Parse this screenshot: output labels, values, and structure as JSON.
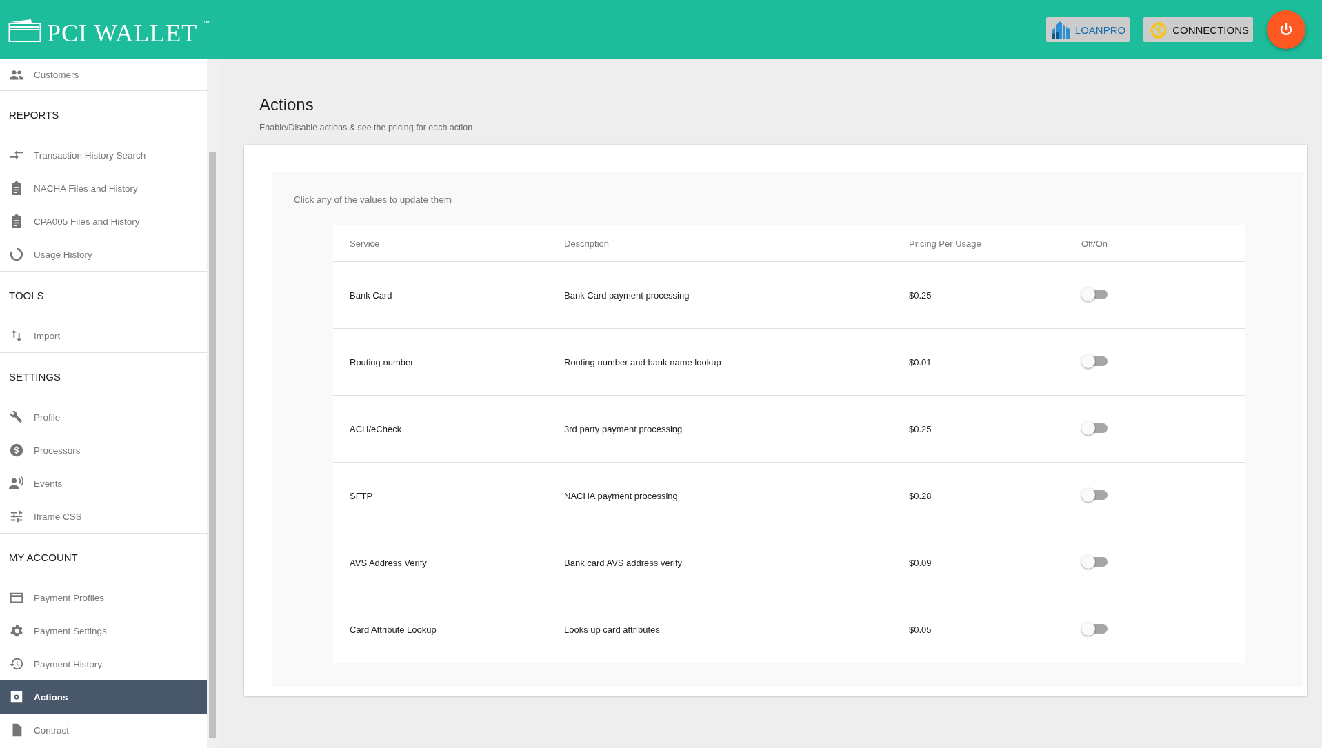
{
  "header": {
    "logo_text": "PCI WALLET",
    "logo_mark": "™",
    "buttons": [
      {
        "kind": "loanpro",
        "label": "LOANPRO"
      },
      {
        "kind": "connections",
        "label": "CONNECTIONS"
      }
    ]
  },
  "sidebar": {
    "sections": [
      {
        "items": [
          {
            "kind": "people",
            "label": "Customers",
            "selected": false
          }
        ]
      },
      {
        "heading": "REPORTS",
        "items": [
          {
            "kind": "swap",
            "label": "Transaction History Search",
            "selected": false
          },
          {
            "kind": "clipboard",
            "label": "NACHA Files and History",
            "selected": false
          },
          {
            "kind": "clipboard",
            "label": "CPA005 Files and History",
            "selected": false
          },
          {
            "kind": "ring",
            "label": "Usage History",
            "selected": false
          }
        ]
      },
      {
        "heading": "TOOLS",
        "items": [
          {
            "kind": "updown",
            "label": "Import",
            "selected": false
          }
        ]
      },
      {
        "heading": "SETTINGS",
        "items": [
          {
            "kind": "wrench",
            "label": "Profile",
            "selected": false
          },
          {
            "kind": "dollar",
            "label": "Processors",
            "selected": false
          },
          {
            "kind": "speaker",
            "label": "Events",
            "selected": false
          },
          {
            "kind": "tune",
            "label": "Iframe CSS",
            "selected": false
          }
        ]
      },
      {
        "heading": "MY ACCOUNT",
        "items": [
          {
            "kind": "card",
            "label": "Payment Profiles",
            "selected": false
          },
          {
            "kind": "gear",
            "label": "Payment Settings",
            "selected": false
          },
          {
            "kind": "history",
            "label": "Payment History",
            "selected": false
          },
          {
            "kind": "gearbox",
            "label": "Actions",
            "selected": true
          },
          {
            "kind": "file",
            "label": "Contract",
            "selected": false
          }
        ]
      }
    ]
  },
  "page": {
    "title": "Actions",
    "subtitle": "Enable/Disable actions & see the pricing for each action",
    "hint": "Click any of the values to update them"
  },
  "table": {
    "columns": [
      "Service",
      "Description",
      "Pricing Per Usage",
      "Off/On"
    ],
    "rows": [
      {
        "service": "Bank Card",
        "description": "Bank Card payment processing",
        "price": "$0.25",
        "on": false
      },
      {
        "service": "Routing number",
        "description": "Routing number and bank name lookup",
        "price": "$0.01",
        "on": false
      },
      {
        "service": "ACH/eCheck",
        "description": "3rd party payment processing",
        "price": "$0.25",
        "on": false
      },
      {
        "service": "SFTP",
        "description": "NACHA payment processing",
        "price": "$0.28",
        "on": false
      },
      {
        "service": "AVS Address Verify",
        "description": "Bank card AVS address verify",
        "price": "$0.09",
        "on": false
      },
      {
        "service": "Card Attribute Lookup",
        "description": "Looks up card attributes",
        "price": "$0.05",
        "on": false
      }
    ]
  }
}
